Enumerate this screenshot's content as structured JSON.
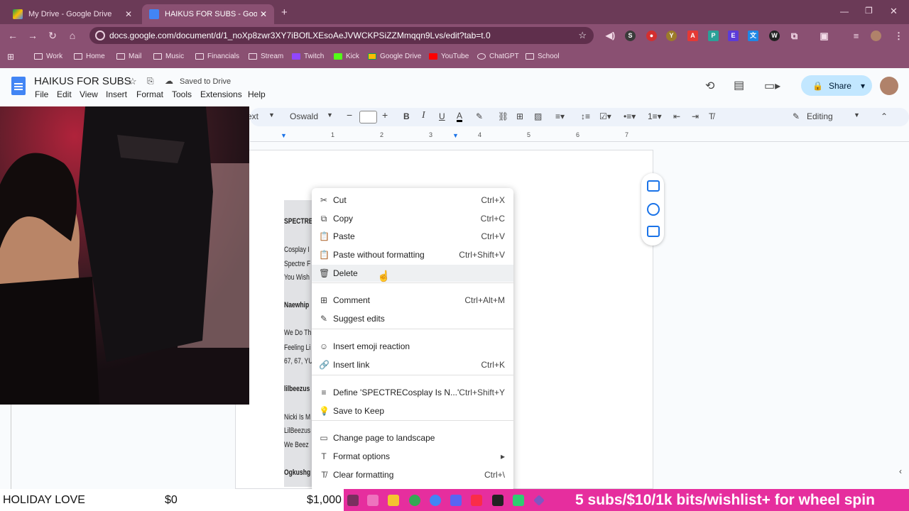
{
  "browser": {
    "tabs": [
      {
        "title": "My Drive - Google Drive",
        "active": false
      },
      {
        "title": "HAIKUS FOR SUBS - Google Do",
        "active": true
      }
    ],
    "url": "docs.google.com/document/d/1_noXp8zwr3XY7iBOfLXEsoAeJVWCKPSiZZMmqqn9Lvs/edit?tab=t.0",
    "bookmarks": [
      "Work",
      "Home",
      "Mail",
      "Music",
      "Financials",
      "Stream",
      "Twitch",
      "Kick",
      "Google Drive",
      "YouTube",
      "ChatGPT",
      "School"
    ]
  },
  "docs": {
    "title": "HAIKUS FOR SUBS",
    "saved_status": "Saved to Drive",
    "menus": [
      "File",
      "Edit",
      "View",
      "Insert",
      "Format",
      "Tools",
      "Extensions",
      "Help"
    ],
    "share_label": "Share",
    "toolbar": {
      "style_partial": "ext",
      "font": "Oswald",
      "mode": "Editing"
    },
    "ruler_numbers": [
      "1",
      "2",
      "3",
      "4",
      "5",
      "6",
      "7"
    ],
    "doc_lines": [
      {
        "text": "SPECTRE",
        "bold": true
      },
      {
        "text": "Cosplay I",
        "bold": false
      },
      {
        "text": "Spectre F",
        "bold": false
      },
      {
        "text": "You Wish",
        "bold": false
      },
      {
        "text": "Naewhip",
        "bold": true
      },
      {
        "text": "We Do Th",
        "bold": false
      },
      {
        "text": "Feeling Li",
        "bold": false
      },
      {
        "text": "67, 67, YU",
        "bold": false
      },
      {
        "text": "lilbeezus",
        "bold": true
      },
      {
        "text": "Nicki Is M",
        "bold": false
      },
      {
        "text": "LilBeezus",
        "bold": false
      },
      {
        "text": "We Beez",
        "bold": false
      },
      {
        "text": "Ogkushg",
        "bold": true
      }
    ]
  },
  "context_menu": [
    {
      "icon": "scissors-icon",
      "glyph": "✂",
      "label": "Cut",
      "shortcut": "Ctrl+X"
    },
    {
      "icon": "copy-icon",
      "glyph": "⧉",
      "label": "Copy",
      "shortcut": "Ctrl+C"
    },
    {
      "icon": "clipboard-icon",
      "glyph": "📋",
      "label": "Paste",
      "shortcut": "Ctrl+V"
    },
    {
      "icon": "clipboard-plain-icon",
      "glyph": "📋",
      "label": "Paste without formatting",
      "shortcut": "Ctrl+Shift+V"
    },
    {
      "icon": "trash-icon",
      "glyph": "🗑",
      "label": "Delete",
      "shortcut": ""
    },
    {
      "icon": "comment-add-icon",
      "glyph": "⊞",
      "label": "Comment",
      "shortcut": "Ctrl+Alt+M"
    },
    {
      "icon": "suggest-icon",
      "glyph": "✎",
      "label": "Suggest edits",
      "shortcut": ""
    },
    {
      "icon": "emoji-icon",
      "glyph": "☺",
      "label": "Insert emoji reaction",
      "shortcut": ""
    },
    {
      "icon": "link-icon",
      "glyph": "🔗",
      "label": "Insert link",
      "shortcut": "Ctrl+K"
    },
    {
      "icon": "book-icon",
      "glyph": "≡",
      "label": "Define 'SPECTRECosplay Is N...'",
      "shortcut": "Ctrl+Shift+Y"
    },
    {
      "icon": "lightbulb-icon",
      "glyph": "💡",
      "label": "Save to Keep",
      "shortcut": ""
    },
    {
      "icon": "page-icon",
      "glyph": "▭",
      "label": "Change page to landscape",
      "shortcut": ""
    },
    {
      "icon": "format-icon",
      "glyph": "T",
      "label": "Format options",
      "shortcut": "▸"
    },
    {
      "icon": "clear-format-icon",
      "glyph": "T̸",
      "label": "Clear formatting",
      "shortcut": "Ctrl+\\"
    }
  ],
  "stream_overlay": {
    "goal_label": "HOLIDAY LOVE",
    "current": "$0",
    "target": "$1,000",
    "ticker": "5 subs/$10/1k bits/wishlist+ for wheel spin"
  }
}
